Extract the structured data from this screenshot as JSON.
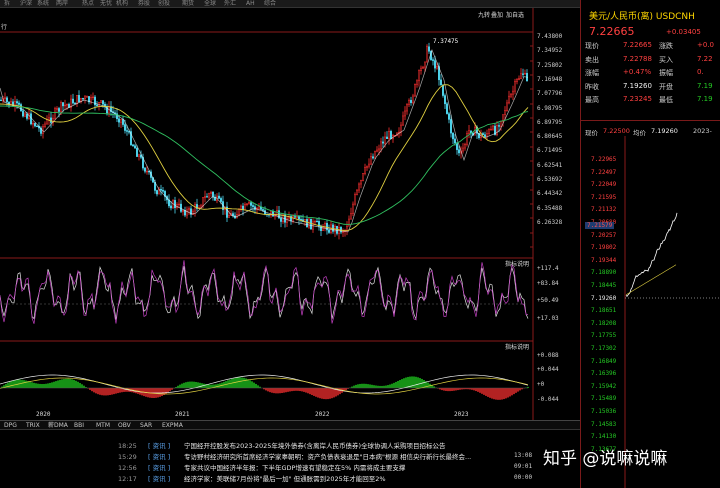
{
  "menu": [
    "拆",
    "沪深",
    "系统",
    "两岸",
    "热点",
    "无忧",
    "机构",
    "券股",
    "创投",
    "期货",
    "全球",
    "外汇",
    "AH",
    "综合"
  ],
  "chart_labels": {
    "top_left": "行",
    "controls": [
      "九转",
      "叠加",
      "加自选"
    ],
    "peak": "7.37475",
    "indicator_tag": "指标说明",
    "years": [
      "2020",
      "2021",
      "2022",
      "2023"
    ]
  },
  "y_main": [
    "7.43800",
    "7.34952",
    "7.25802",
    "7.16948",
    "7.07796",
    "6.98795",
    "6.89795",
    "6.80645",
    "6.71495",
    "6.62541",
    "6.53692",
    "6.44342",
    "6.35488",
    "6.26328"
  ],
  "y_osc": [
    "117.4",
    "83.84",
    "50.49",
    "17.03"
  ],
  "y_macd": [
    "0.088",
    "0.044",
    "0",
    "-0.044"
  ],
  "tabs": [
    "DPG",
    "TRIX",
    "薪DMA",
    "BBI",
    "MTM",
    "OBV",
    "SAR",
    "EXPMA"
  ],
  "news": [
    {
      "time": "18:25",
      "cat": "[ 资讯 ]",
      "text": "宁国经开控股发布2023-2025年境外债券(含离岸人民币债券)全球协调人采购项目招标公告"
    },
    {
      "time": "15:29",
      "cat": "[ 资讯 ]",
      "text": "专访野村经济研究所首席经济学家辜朝明：资产负债表衰退是\"日本病\"根源 相信央行新行长最终会..."
    },
    {
      "time": "12:56",
      "cat": "[ 资讯 ]",
      "text": "专家共议中国经济半年报：下半年GDP增速有望稳定在5% 内需将成主要支撑"
    },
    {
      "time": "12:17",
      "cat": "[ 资讯 ]",
      "text": "经济学家：美联储7月份将\"最后一加\" 但通胀需到2025年才能回至2%"
    }
  ],
  "news_side": [
    "13:08",
    "09:01",
    "00:00"
  ],
  "quote": {
    "title": "美元/人民币(离) USDCNH",
    "price": "7.22665",
    "change": "+0.03405",
    "change_pct": "+0.47%",
    "rows": [
      {
        "label": "现价",
        "value": "7.22665",
        "label2": "涨跌",
        "value2": "+0.0"
      },
      {
        "label": "卖出",
        "value": "7.22788",
        "label2": "买入",
        "value2": "7.22"
      },
      {
        "label": "涨幅",
        "value": "+0.47%",
        "label2": "振幅",
        "value2": "0."
      },
      {
        "label": "昨收",
        "value": "7.19260",
        "label2": "开盘",
        "value2": "7.19"
      },
      {
        "label": "最高",
        "value": "7.23245",
        "label2": "最低",
        "value2": "7.19"
      }
    ],
    "mini_header": {
      "label": "现价",
      "now": "7.22500",
      "avg_label": "均价",
      "avg": "7.19260",
      "extra": "2023-"
    },
    "mini_prices": [
      "7.22965",
      "7.22497",
      "7.22049",
      "7.21595",
      "7.21132",
      "7.20680",
      "7.20257",
      "7.19802",
      "7.19344",
      "7.18890",
      "7.18445",
      "7.19260",
      "7.18651",
      "7.18208",
      "7.17755",
      "7.17302",
      "7.16849",
      "7.16396",
      "7.15942",
      "7.15489",
      "7.15036",
      "7.14583",
      "7.14130",
      "7.13677"
    ],
    "mini_box": "7.21579"
  },
  "watermark": "知乎 @说嘛说嘛"
}
